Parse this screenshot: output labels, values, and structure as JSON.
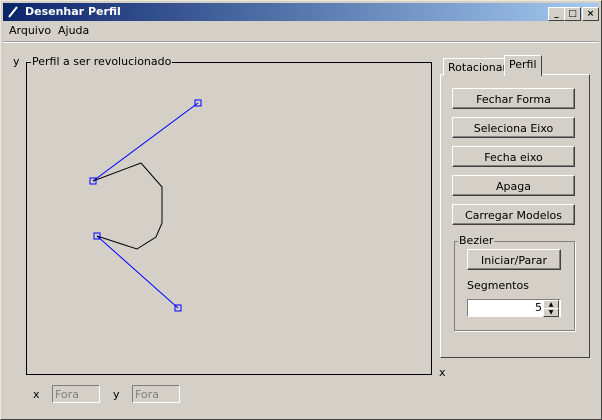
{
  "window": {
    "title": "Desenhar Perfil"
  },
  "menu": {
    "items": [
      "Arquivo",
      "Ajuda"
    ]
  },
  "canvas": {
    "title": "Perfil a ser revolucionado",
    "y_label": "y",
    "x_label": "x"
  },
  "tabs": {
    "items": [
      "Rotacionar",
      "Perfil"
    ],
    "active": "Perfil"
  },
  "buttons": {
    "fechar_forma": "Fechar Forma",
    "seleciona_eixo": "Seleciona Eixo",
    "fecha_eixo": "Fecha eixo",
    "apaga": "Apaga",
    "carregar_modelos": "Carregar Modelos"
  },
  "bezier": {
    "title": "Bezier",
    "start_stop": "Iniciar/Parar",
    "segments_label": "Segmentos",
    "segments_value": "5"
  },
  "status": {
    "x_label": "x",
    "x_value": "Fora",
    "y_label": "y",
    "y_value": "Fora"
  },
  "colors": {
    "control_line": "#0000ff",
    "curve": "#000000"
  }
}
